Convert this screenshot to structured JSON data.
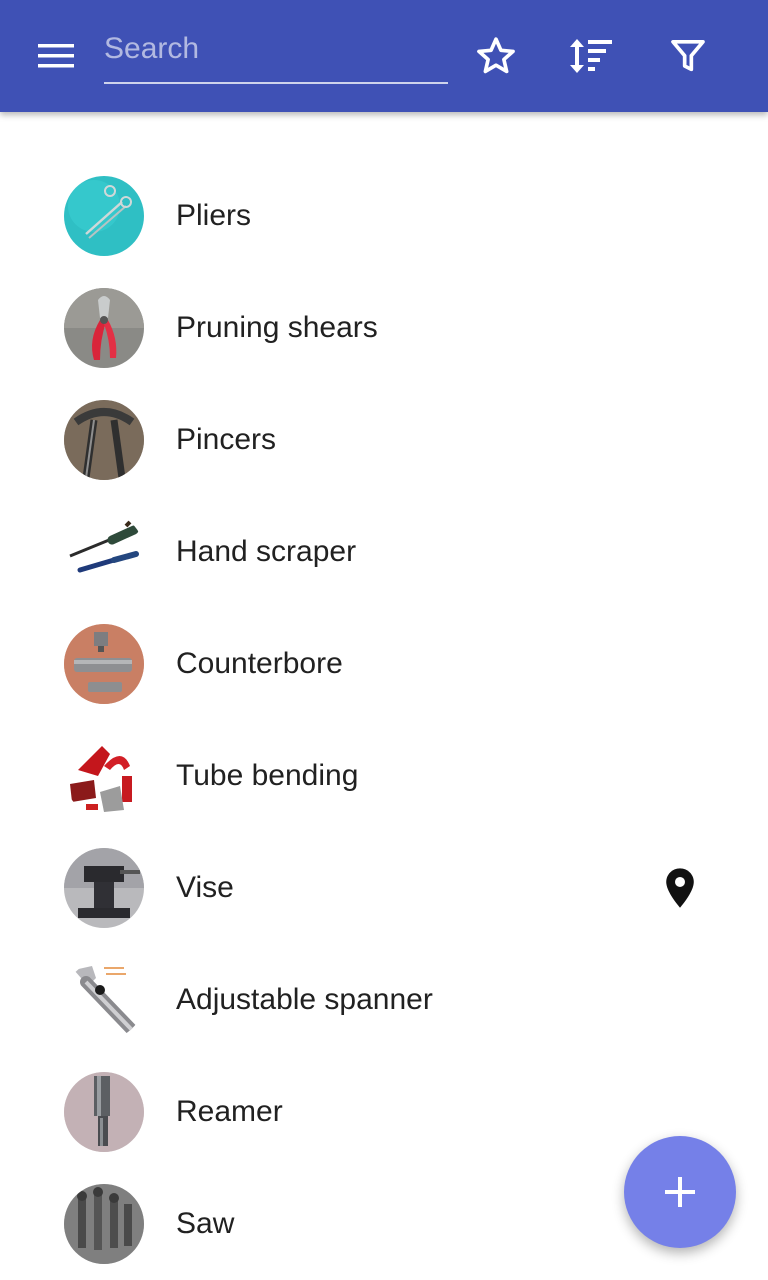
{
  "toolbar": {
    "search_placeholder": "Search",
    "search_value": "",
    "icons": [
      "menu-icon",
      "star-outline-icon",
      "sort-icon",
      "filter-icon"
    ],
    "color": "#3f51b5"
  },
  "tools": [
    {
      "label": "Pliers",
      "icon": "pliers"
    },
    {
      "label": "Pruning shears",
      "icon": "pruning-shears"
    },
    {
      "label": "Pincers",
      "icon": "pincers"
    },
    {
      "label": "Hand scraper",
      "icon": "hand-scraper"
    },
    {
      "label": "Counterbore",
      "icon": "counterbore"
    },
    {
      "label": "Tube bending",
      "icon": "tube-bending"
    },
    {
      "label": "Vise",
      "icon": "vise",
      "marker": "location-pin-icon"
    },
    {
      "label": "Adjustable spanner",
      "icon": "adjustable-spanner"
    },
    {
      "label": "Reamer",
      "icon": "reamer"
    },
    {
      "label": "Saw",
      "icon": "saw"
    }
  ],
  "fab": {
    "icon": "plus-icon",
    "color": "#7580e8"
  }
}
